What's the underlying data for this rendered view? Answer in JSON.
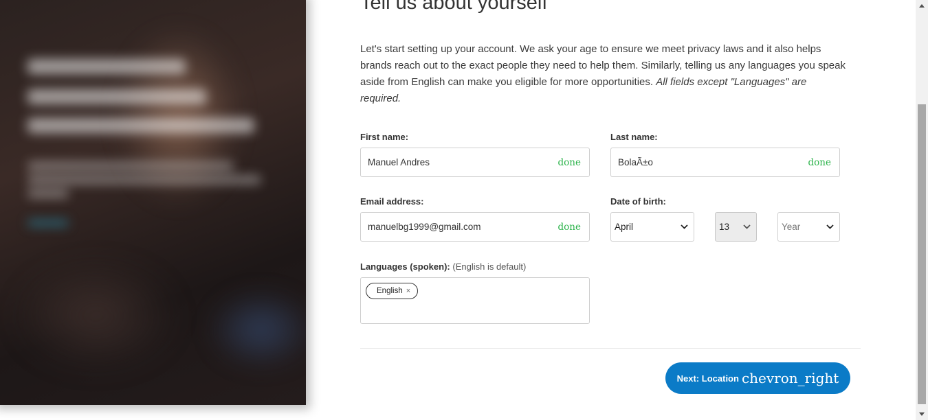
{
  "page": {
    "title": "Tell us about yourself",
    "intro_text": "Let's start setting up your account. We ask your age to ensure we meet privacy laws and it also helps brands reach out to the exact people they need to help them. Similarly, telling us any languages you speak aside from English can make you eligible for more opportunities. ",
    "intro_emphasis": "All fields except \"Languages\" are required."
  },
  "form": {
    "first_name": {
      "label": "First name:",
      "value": "Manuel Andres",
      "status": "done"
    },
    "last_name": {
      "label": "Last name:",
      "value": "BolaÃ±o",
      "status": "done"
    },
    "email": {
      "label": "Email address:",
      "value": "manuelbg1999@gmail.com",
      "status": "done"
    },
    "dob": {
      "label": "Date of birth:",
      "month": "April",
      "day": "13",
      "year_placeholder": "Year"
    },
    "languages": {
      "label": "Languages (spoken):",
      "hint": "(English is default)",
      "chips": [
        {
          "label": "English",
          "remove": "×"
        }
      ]
    }
  },
  "actions": {
    "next_label": "Next: Location",
    "next_icon_text": "chevron_right"
  },
  "colors": {
    "accent": "#0b7bc7",
    "success": "#2bb34a"
  }
}
